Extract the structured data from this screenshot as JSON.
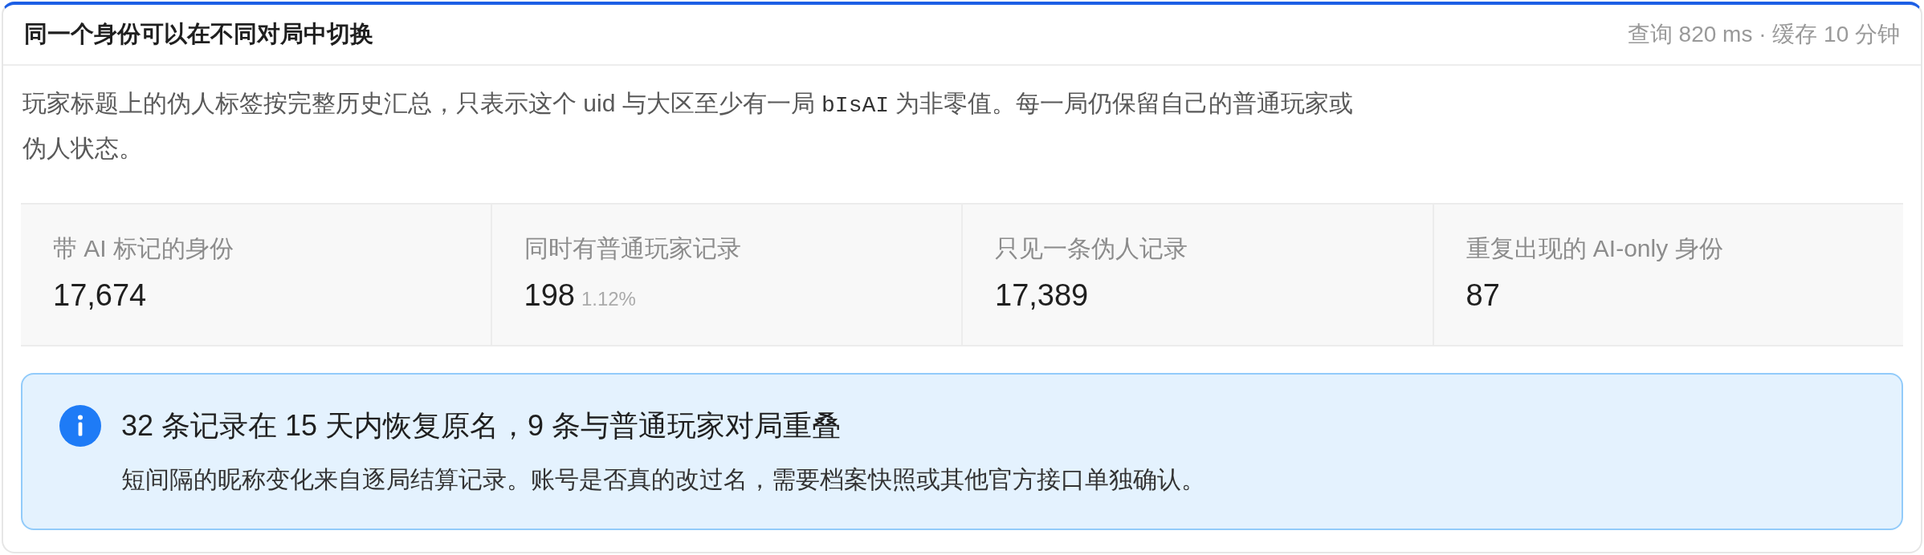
{
  "panel": {
    "title": "同一个身份可以在不同对局中切换",
    "meta": "查询 820 ms · 缓存 10 分钟"
  },
  "description": [
    {
      "kind": "text",
      "text": "玩家标题上的伪人标签按完整历史汇总，只表示这个 uid 与大区至少有一局 "
    },
    {
      "kind": "code",
      "text": "bIsAI"
    },
    {
      "kind": "text",
      "text": " 为非零值。每一局仍保留自己的普通玩家或伪人状态。"
    }
  ],
  "stats": [
    {
      "label": "带 AI 标记的身份",
      "value": "17,674"
    },
    {
      "label": "同时有普通玩家记录",
      "value": "198",
      "share": "1.12%"
    },
    {
      "label": "只见一条伪人记录",
      "value": "17,389"
    },
    {
      "label": "重复出现的 AI-only 身份",
      "value": "87"
    }
  ],
  "alert": {
    "kind": "info",
    "title": "32 条记录在 15 天内恢复原名，9 条与普通玩家对局重叠",
    "message": "短间隔的昵称变化来自逐局结算记录。账号是否真的改过名，需要档案快照或其他官方接口单独确认。"
  }
}
